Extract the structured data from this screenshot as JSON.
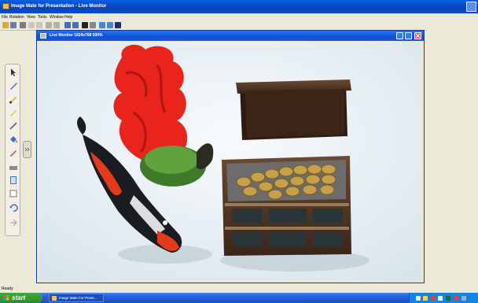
{
  "app": {
    "title": "Image Mate for Presentation - Live Monitor",
    "menu": [
      "File",
      "Rotation",
      "View",
      "Tools",
      "Window",
      "Help"
    ]
  },
  "inner_window": {
    "title": "Live Monitor 1024x768 500%"
  },
  "status": {
    "text": "Ready"
  },
  "taskbar": {
    "start_label": "start",
    "task_label": "Image Mate For Prese..."
  },
  "icons": {
    "palette": [
      "cursor-icon",
      "pen-icon",
      "brush-icon",
      "highlighter-icon",
      "line-icon",
      "fill-icon",
      "marker-icon",
      "eraser-icon",
      "page-icon",
      "screen-icon",
      "undo-icon",
      "arrow-icon"
    ]
  },
  "colors": {
    "titlebar": "#0a5fe3",
    "taskbar": "#245edb",
    "start": "#3fa93f",
    "close": "#e0503a"
  }
}
